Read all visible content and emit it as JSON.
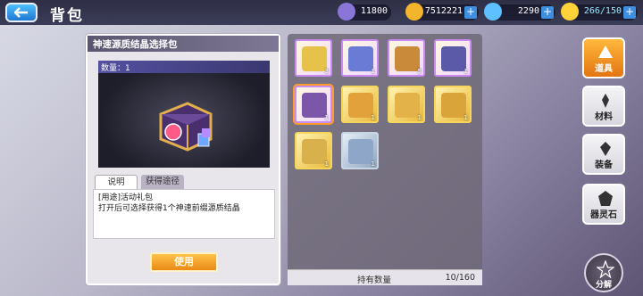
{
  "header": {
    "title": "背包",
    "resources": [
      {
        "name": "potion",
        "value": "11800",
        "color": "#8a76d8"
      },
      {
        "name": "gold-coin",
        "value": "7512221",
        "color": "#f2b52b"
      },
      {
        "name": "crystal",
        "value": "2290",
        "color": "#5ec0ff"
      },
      {
        "name": "stamina",
        "value": "266/150",
        "color": "#ffd23a"
      }
    ]
  },
  "detail": {
    "item_name": "神速源质结晶选择包",
    "quantity_label": "数量：1",
    "tabs": [
      "说明",
      "获得途径"
    ],
    "description": [
      "[用途]活动礼包",
      "打开后可选择获得1个神速前缀源质结晶"
    ],
    "use_button": "使用"
  },
  "inventory": {
    "slots": [
      {
        "type": "rainbow",
        "color": "#e7c24a",
        "count": "3",
        "selected": false
      },
      {
        "type": "rainbow",
        "color": "#6a7bd6",
        "count": "1",
        "selected": false
      },
      {
        "type": "rainbow",
        "color": "#c98a3a",
        "count": "5",
        "selected": false
      },
      {
        "type": "rainbow",
        "color": "#5a5aa8",
        "count": "1",
        "selected": false
      },
      {
        "type": "rainbow",
        "color": "#7c56a8",
        "count": "1",
        "selected": true
      },
      {
        "type": "gold",
        "color": "#e2a13a",
        "count": "1",
        "selected": false
      },
      {
        "type": "gold",
        "color": "#e3b34a",
        "count": "1",
        "selected": false
      },
      {
        "type": "gold",
        "color": "#d9a53b",
        "count": "1",
        "selected": false
      },
      {
        "type": "gold",
        "color": "#d8b14c",
        "count": "1",
        "selected": false
      },
      {
        "type": "silver",
        "color": "#8ea7c8",
        "count": "1",
        "selected": false
      }
    ],
    "footer_label": "持有数量",
    "footer_count": "10/160"
  },
  "sidebar": [
    {
      "label": "道具",
      "active": true,
      "icon": "item-icon"
    },
    {
      "label": "材料",
      "active": false,
      "icon": "material-icon"
    },
    {
      "label": "装备",
      "active": false,
      "icon": "equip-icon"
    },
    {
      "label": "器灵石",
      "active": false,
      "icon": "spirit-stone-icon"
    }
  ],
  "decompose_label": "分解"
}
